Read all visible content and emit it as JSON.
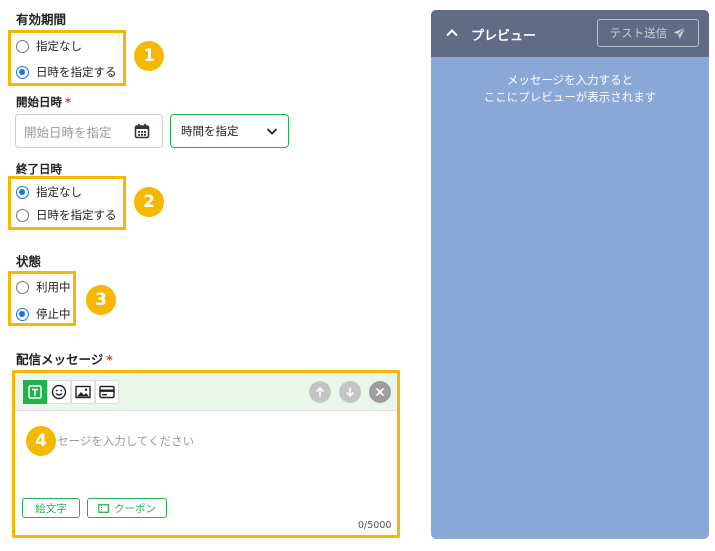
{
  "validity": {
    "label": "有効期間",
    "options": [
      "指定なし",
      "日時を指定する"
    ],
    "selected": 1
  },
  "start": {
    "label": "開始日時",
    "required_mark": "*",
    "date_placeholder": "開始日時を指定",
    "time_value": "時間を指定"
  },
  "end": {
    "label": "終了日時",
    "options": [
      "指定なし",
      "日時を指定する"
    ],
    "selected": 0
  },
  "status": {
    "label": "状態",
    "options": [
      "利用中",
      "停止中"
    ],
    "selected": 1
  },
  "message": {
    "label": "配信メッセージ",
    "required_mark": "*",
    "placeholder": "メッセージを入力してください",
    "emoji_button": "絵文字",
    "coupon_button": "クーポン",
    "counter": "0/5000"
  },
  "badges": [
    "1",
    "2",
    "3",
    "4"
  ],
  "preview": {
    "title": "プレビュー",
    "test_send": "テスト送信",
    "empty_line1": "メッセージを入力すると",
    "empty_line2": "ここにプレビューが表示されます"
  },
  "icons": {
    "collapse": "chevron-up-icon",
    "send": "paper-plane-icon",
    "calendar": "calendar-icon",
    "dropdown": "chevron-down-icon",
    "text": "text-icon",
    "emoji": "smiley-icon",
    "image": "image-icon",
    "card": "card-icon",
    "up": "arrow-up-icon",
    "down": "arrow-down-icon",
    "delete": "close-circle-icon",
    "coupon": "ticket-icon"
  },
  "colors": {
    "highlight": "#f5b800",
    "accent_green": "#22b14c",
    "radio_blue": "#1a73e8",
    "preview_bg": "#8aa8d7",
    "preview_header": "#5f6c83"
  }
}
